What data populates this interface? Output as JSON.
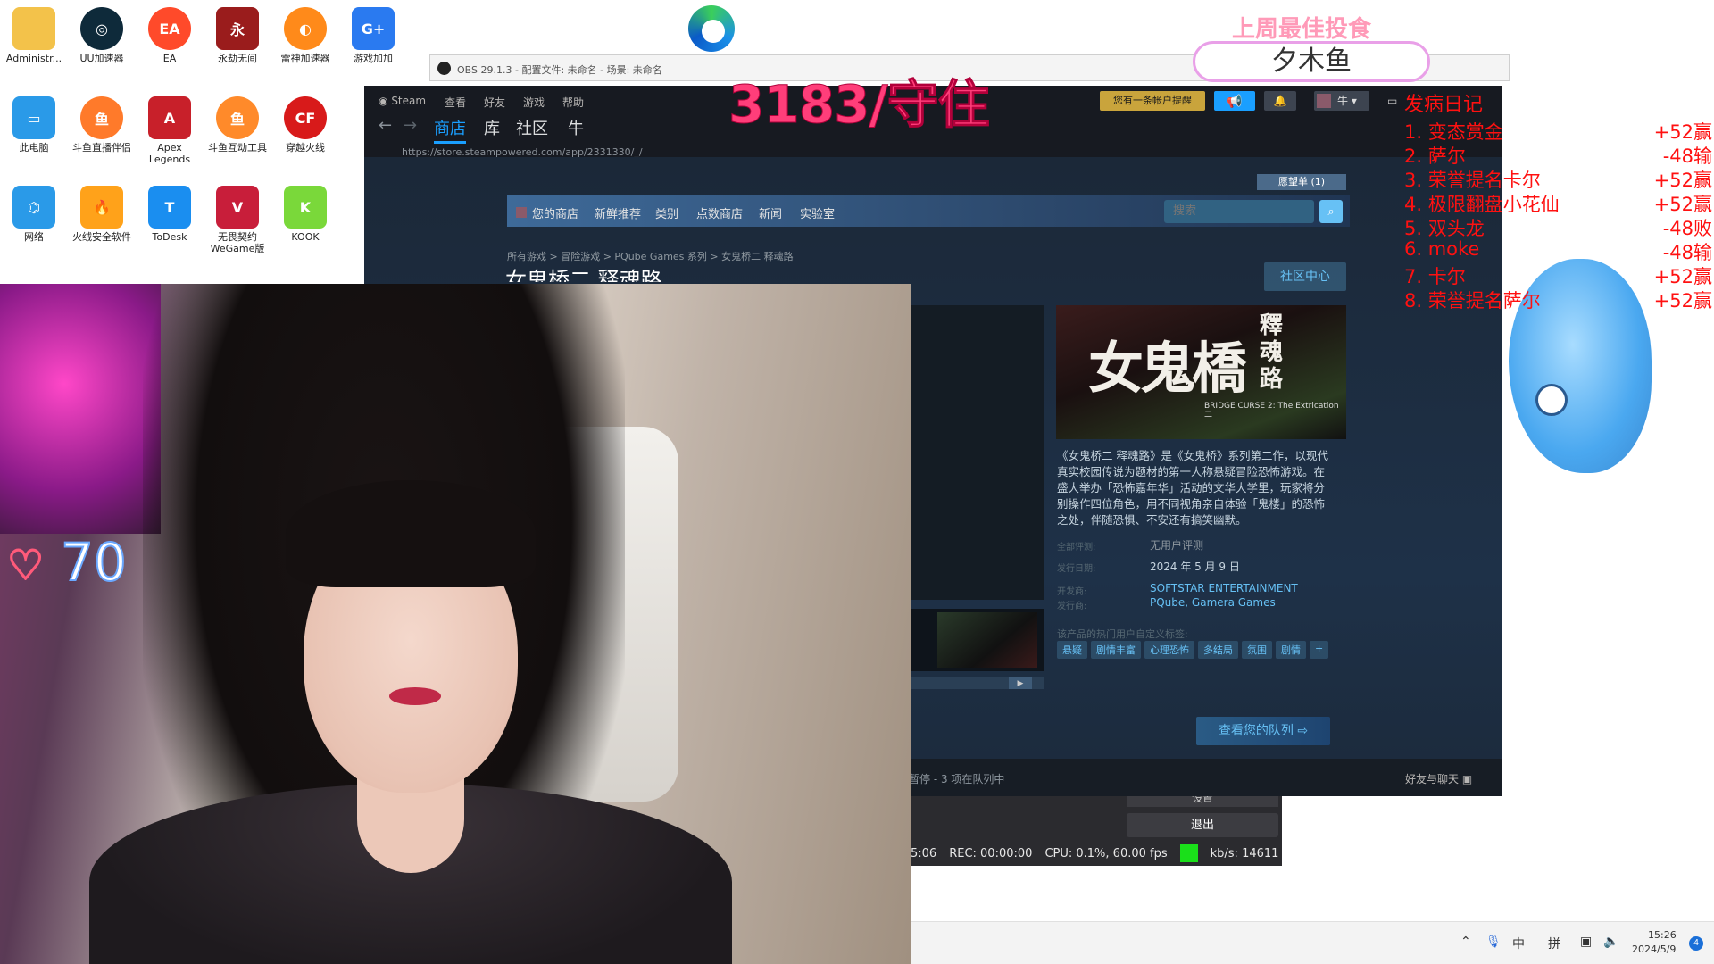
{
  "desktop": {
    "icons": [
      {
        "label": "Administr..."
      },
      {
        "label": "UU加速器"
      },
      {
        "label": "EA"
      },
      {
        "label": "永劫无间"
      },
      {
        "label": "雷神加速器"
      },
      {
        "label": "游戏加加"
      },
      {
        "label": "此电脑"
      },
      {
        "label": "斗鱼直播伴侣"
      },
      {
        "label": "Apex Legends"
      },
      {
        "label": "斗鱼互动工具"
      },
      {
        "label": "穿越火线"
      },
      {
        "label": "网络"
      },
      {
        "label": "火绒安全软件"
      },
      {
        "label": "ToDesk"
      },
      {
        "label": "无畏契约 WeGame版"
      },
      {
        "label": "KOOK"
      }
    ]
  },
  "obs": {
    "title": "OBS 29.1.3 - 配置文件: 未命名 - 场景: 未命名",
    "exit_label": "退出",
    "settings_label": "设置",
    "status": {
      "time": "5:06",
      "rec": "REC: 00:00:00",
      "cpu": "CPU: 0.1%, 60.00 fps",
      "kbps": "kb/s: 14611"
    }
  },
  "steam": {
    "menu": [
      "Steam",
      "查看",
      "好友",
      "游戏",
      "帮助"
    ],
    "nav": {
      "store": "商店",
      "library": "库",
      "community": "社区",
      "user": "牛"
    },
    "url": "https://store.steampowered.com/app/2331330/_/",
    "notify_label": "您有一条帐户提醒",
    "user_label": "牛",
    "wishlist_label": "愿望单 (1)",
    "store_nav": [
      "您的商店",
      "新鲜推荐",
      "类别",
      "点数商店",
      "新闻",
      "实验室"
    ],
    "search_placeholder": "搜索",
    "breadcrumb": "所有游戏 > 冒险游戏 > PQube Games 系列 > 女鬼桥二 释魂路",
    "game_title": "女鬼桥二 释魂路",
    "community_hub": "社区中心",
    "capsule": {
      "title": "女鬼橋",
      "subtitle": "釋魂路",
      "english": "BRIDGE CURSE 2: The Extrication",
      "number": "二"
    },
    "description": "《女鬼桥二 释魂路》是《女鬼桥》系列第二作，以现代真实校园传说为题材的第一人称悬疑冒险恐怖游戏。在盛大举办「恐怖嘉年华」活动的文华大学里，玩家将分别操作四位角色，用不同视角亲自体验「鬼楼」的恐怖之处，伴随恐惧、不安还有搞笑幽默。",
    "meta": {
      "reviews_label": "全部评测:",
      "reviews_value": "无用户评测",
      "release_label": "发行日期:",
      "release_value": "2024 年 5 月 9 日",
      "developer_label": "开发商:",
      "developer_value": "SOFTSTAR ENTERTAINMENT",
      "publisher_label": "发行商:",
      "publisher_value": "PQube, Gamera Games"
    },
    "tags_label": "该产品的热门用户自定义标签:",
    "tags": [
      "悬疑",
      "剧情丰富",
      "心理恐怖",
      "多结局",
      "氛围",
      "剧情",
      "+"
    ],
    "queue_label": "查看您的队列",
    "footer_status": "暂停 - 3 项在队列中",
    "footer_friends": "好友与聊天"
  },
  "overlay": {
    "count": "3183/守住",
    "top_food_title": "上周最佳投食",
    "top_food_name": "夕木鱼",
    "heart_count": "70",
    "diary": {
      "title": "发病日记",
      "rows": [
        {
          "name": "1. 变态赏金",
          "result": "+52赢"
        },
        {
          "name": "2. 萨尔",
          "result": "-48输"
        },
        {
          "name": "3. 荣誉提名卡尔",
          "result": "+52赢"
        },
        {
          "name": "4. 极限翻盘小花仙",
          "result": "+52赢"
        },
        {
          "name": "5. 双头龙",
          "result": "-48败"
        },
        {
          "name": "6. moke",
          "result": "-48输"
        },
        {
          "name": "7. 卡尔",
          "result": "+52赢"
        },
        {
          "name": "8. 荣誉提名萨尔",
          "result": "+52赢"
        }
      ]
    }
  },
  "taskbar": {
    "ime_1": "中",
    "ime_2": "拼",
    "time": "15:26",
    "date": "2024/5/9",
    "notifications": "4"
  }
}
